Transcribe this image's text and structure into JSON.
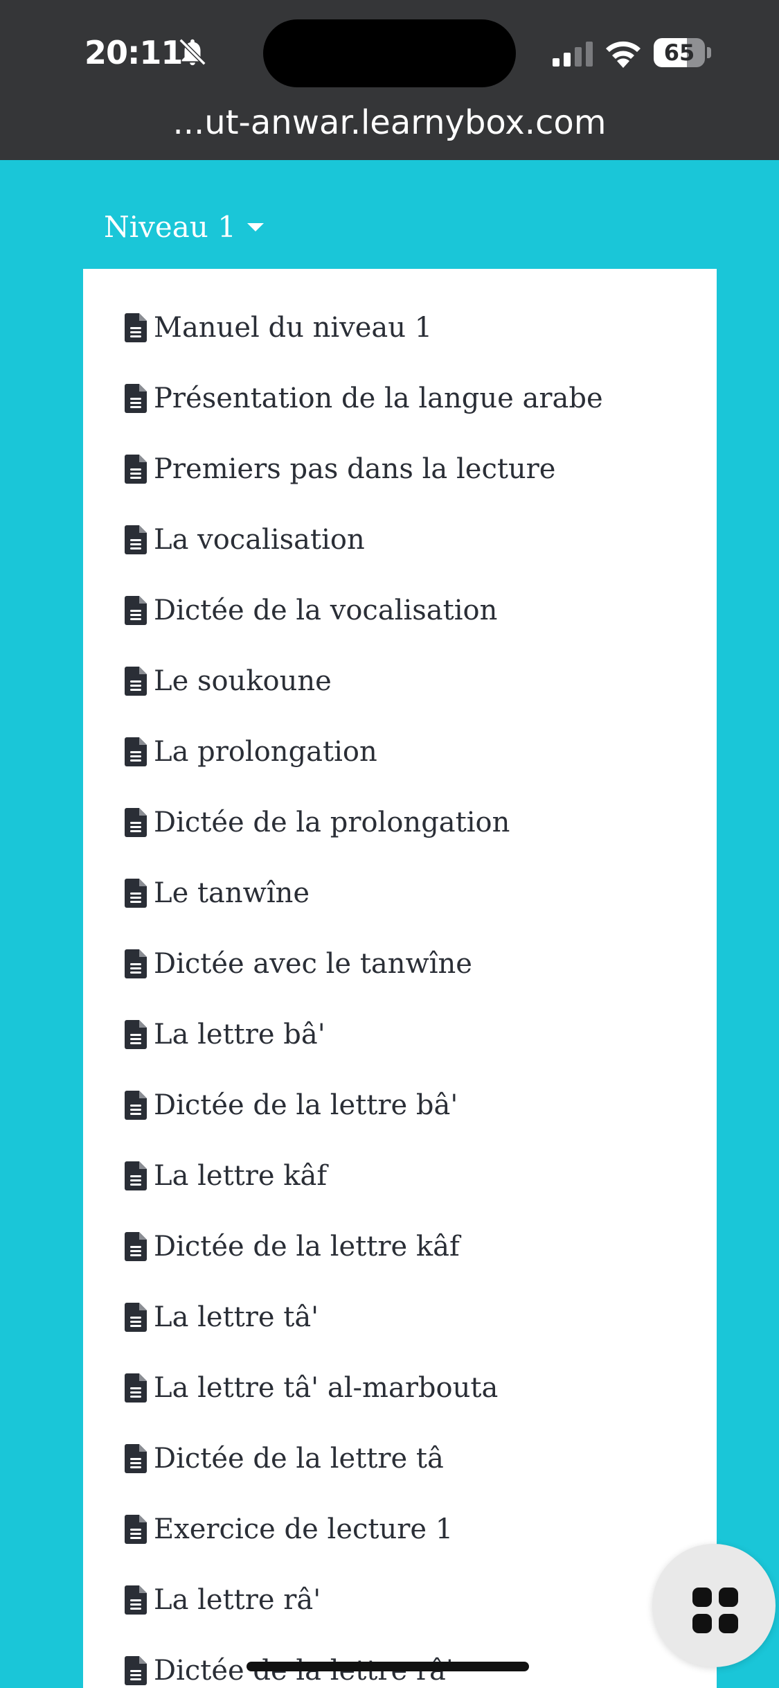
{
  "status_bar": {
    "time": "20:11",
    "battery_level": 65,
    "battery_label": "65"
  },
  "browser": {
    "url": "...ut-anwar.learnybox.com"
  },
  "dropdown": {
    "label": "Niveau 1",
    "items": [
      {
        "label": "Manuel du niveau 1"
      },
      {
        "label": "Présentation de la langue arabe"
      },
      {
        "label": "Premiers pas dans la lecture"
      },
      {
        "label": "La vocalisation"
      },
      {
        "label": "Dictée de la vocalisation"
      },
      {
        "label": "Le soukoune"
      },
      {
        "label": "La prolongation"
      },
      {
        "label": "Dictée de la prolongation"
      },
      {
        "label": "Le tanwîne"
      },
      {
        "label": "Dictée avec le tanwîne"
      },
      {
        "label": "La lettre bâ'"
      },
      {
        "label": "Dictée de la lettre bâ'"
      },
      {
        "label": "La lettre kâf"
      },
      {
        "label": "Dictée de la lettre kâf"
      },
      {
        "label": "La lettre tâ'"
      },
      {
        "label": "La lettre tâ' al-marbouta"
      },
      {
        "label": "Dictée de la lettre tâ"
      },
      {
        "label": "Exercice de lecture 1"
      },
      {
        "label": "La lettre râ'"
      },
      {
        "label": "Dictée de la lettre râ'"
      }
    ]
  },
  "icons": {
    "item_icon": "file-text-icon",
    "fab_icon": "grid-icon"
  },
  "colors": {
    "page_background": "#1ac6d8",
    "browser_bar": "#353638",
    "menu_background": "#ffffff",
    "menu_text": "#2a2e36"
  }
}
